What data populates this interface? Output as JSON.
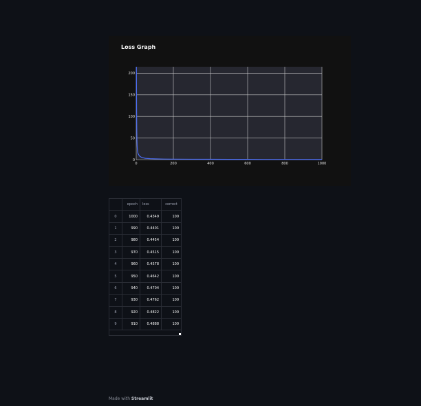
{
  "chart": {
    "title": "Loss Graph"
  },
  "chart_data": {
    "type": "line",
    "title": "Loss Graph",
    "xlabel": "",
    "ylabel": "",
    "xlim": [
      0,
      1000
    ],
    "ylim": [
      0,
      215
    ],
    "x_ticks": [
      "0",
      "200",
      "400",
      "600",
      "800",
      "1000"
    ],
    "y_ticks": [
      "0",
      "50",
      "100",
      "150",
      "200"
    ],
    "grid": true,
    "line_color": "#4c6ef5",
    "series": [
      {
        "x": [
          1,
          2,
          3,
          4,
          5,
          6,
          8,
          10,
          15,
          20,
          30,
          50,
          75,
          100,
          150,
          200,
          300,
          400,
          500,
          600,
          700,
          800,
          900,
          1000
        ],
        "values": [
          215,
          120,
          70,
          45,
          32,
          25,
          18,
          14,
          10,
          7.5,
          5,
          3,
          2.2,
          1.8,
          1.3,
          1.1,
          0.9,
          0.75,
          0.65,
          0.58,
          0.52,
          0.48,
          0.46,
          0.43
        ]
      }
    ]
  },
  "table": {
    "columns": [
      "epoch",
      "loss",
      "correct"
    ],
    "rows": [
      {
        "idx": "0",
        "epoch": "1000",
        "loss": "0.4349",
        "correct": "100"
      },
      {
        "idx": "1",
        "epoch": "990",
        "loss": "0.4401",
        "correct": "100"
      },
      {
        "idx": "2",
        "epoch": "980",
        "loss": "0.4454",
        "correct": "100"
      },
      {
        "idx": "3",
        "epoch": "970",
        "loss": "0.4515",
        "correct": "100"
      },
      {
        "idx": "4",
        "epoch": "960",
        "loss": "0.4578",
        "correct": "100"
      },
      {
        "idx": "5",
        "epoch": "950",
        "loss": "0.4642",
        "correct": "100"
      },
      {
        "idx": "6",
        "epoch": "940",
        "loss": "0.4704",
        "correct": "100"
      },
      {
        "idx": "7",
        "epoch": "930",
        "loss": "0.4762",
        "correct": "100"
      },
      {
        "idx": "8",
        "epoch": "920",
        "loss": "0.4822",
        "correct": "100"
      },
      {
        "idx": "9",
        "epoch": "910",
        "loss": "0.4888",
        "correct": "100"
      }
    ]
  },
  "footer": {
    "prefix": "Made with",
    "brand": "Streamlit"
  }
}
